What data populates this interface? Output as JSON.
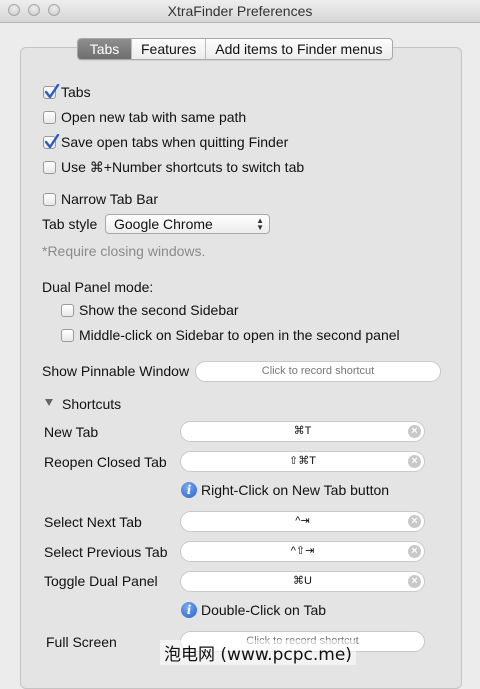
{
  "window": {
    "title": "XtraFinder Preferences"
  },
  "tabs": [
    "Tabs",
    "Features",
    "Add items to Finder menus"
  ],
  "options": {
    "tabs": {
      "label": "Tabs",
      "checked": true
    },
    "new_tab_same_path": {
      "label": "Open new tab with same path",
      "checked": false
    },
    "save_open_tabs": {
      "label": "Save open tabs when quitting Finder",
      "checked": true
    },
    "cmd_number": {
      "label": "Use ⌘+Number shortcuts to switch tab",
      "checked": false
    },
    "narrow_tab_bar": {
      "label": "Narrow Tab Bar",
      "checked": false
    }
  },
  "tab_style": {
    "label": "Tab style",
    "value": "Google Chrome"
  },
  "require_note": "*Require closing windows.",
  "dual_panel": {
    "label": "Dual Panel mode:",
    "second_sidebar": {
      "label": "Show the second Sidebar",
      "checked": false
    },
    "middle_click": {
      "label": "Middle-click on Sidebar to open in the second panel",
      "checked": false
    }
  },
  "pinnable": {
    "label": "Show Pinnable Window",
    "placeholder": "Click to record shortcut"
  },
  "shortcuts": {
    "header": "Shortcuts",
    "new_tab": {
      "label": "New Tab",
      "value": "⌘T"
    },
    "reopen": {
      "label": "Reopen Closed Tab",
      "value": "⇧⌘T"
    },
    "info1": "Right-Click on New Tab button",
    "next_tab": {
      "label": "Select Next Tab",
      "value": "^⇥"
    },
    "prev_tab": {
      "label": "Select Previous Tab",
      "value": "^⇧⇥"
    },
    "toggle_dual": {
      "label": "Toggle Dual Panel",
      "value": "⌘U"
    },
    "info2": "Double-Click on Tab",
    "full_screen": {
      "label": "Full Screen",
      "placeholder": "Click to record shortcut"
    }
  },
  "watermark": "泡电网 (www.pcpc.me)"
}
